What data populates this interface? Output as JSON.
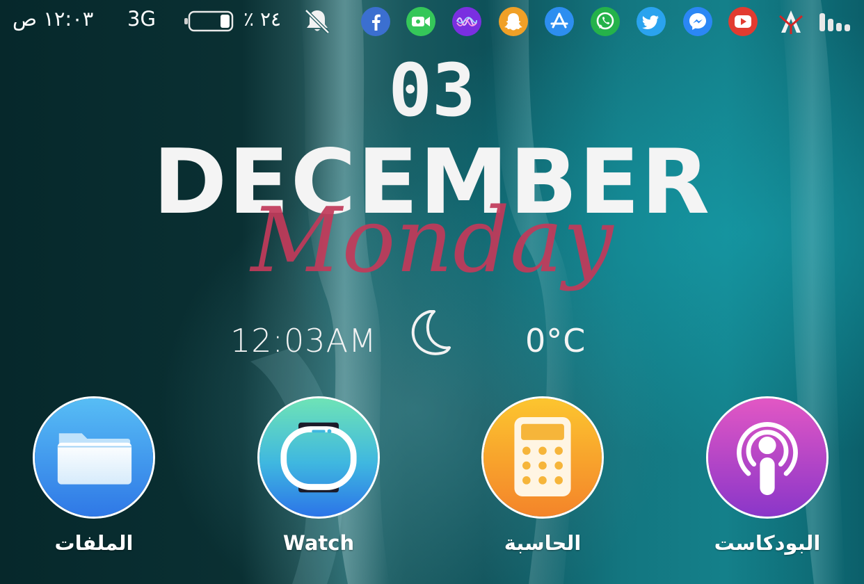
{
  "status_bar": {
    "time": "١٢:٠٣ ص",
    "network": "3G",
    "battery_percent_text": "٢٤ ٪",
    "battery_level": 0.24,
    "icons": [
      "muted-bell-icon",
      "facebook-icon",
      "facetime-icon",
      "siri-icon",
      "snapchat-icon",
      "app-store-icon",
      "whatsapp-icon",
      "twitter-icon",
      "messenger-icon",
      "youtube-icon",
      "altstore-icon",
      "signal-bars-icon"
    ]
  },
  "widget": {
    "day": "03",
    "month": "DECEMBER",
    "weekday": "Monday",
    "time": "12:03AM",
    "weather_icon": "crescent-moon-icon",
    "temperature": "0°C"
  },
  "apps": [
    {
      "label": "الملفات",
      "icon": "files-icon"
    },
    {
      "label": "Watch",
      "icon": "watch-icon"
    },
    {
      "label": "الحاسبة",
      "icon": "calculator-icon"
    },
    {
      "label": "البودكاست",
      "icon": "podcasts-icon"
    }
  ],
  "colors": {
    "weekday_accent": "#c23a5a",
    "background_teal": "#137680",
    "background_dark": "#06282b"
  }
}
